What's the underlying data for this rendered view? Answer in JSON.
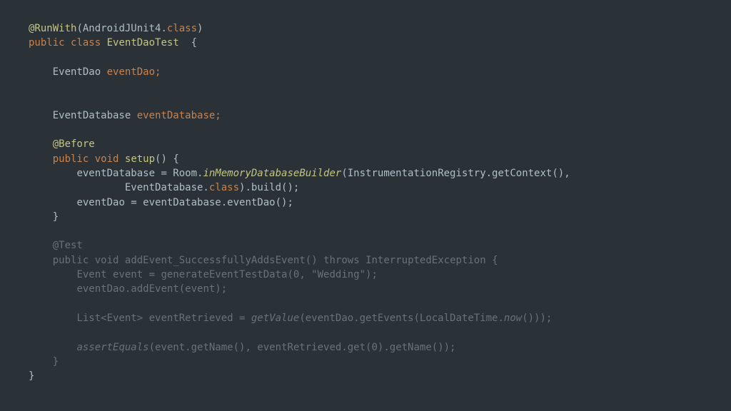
{
  "code": {
    "l1_ann": "@RunWith",
    "l1_open": "(AndroidJUnit4.",
    "l1_class": "class",
    "l1_close": ")",
    "l2_pub": "public",
    "l2_class": "class",
    "l2_name": "EventDaoTest",
    "l2_brace": "  {",
    "l4_type": "EventDao",
    "l4_field": "eventDao;",
    "l7_type": "EventDatabase",
    "l7_field": "eventDatabase;",
    "l9_ann": "@Before",
    "l10_pub": "public",
    "l10_void": "void",
    "l10_fn": "setup",
    "l10_tail": "() {",
    "l11_a": "eventDatabase = Room.",
    "l11_b": "inMemoryDatabaseBuilder",
    "l11_c": "(InstrumentationRegistry.getContext(),",
    "l12_a": "EventDatabase.",
    "l12_b": "class",
    "l12_c": ").build();",
    "l13": "eventDao = eventDatabase.eventDao();",
    "l14": "}",
    "l16_ann": "@Test",
    "l17_pub": "public",
    "l17_void": "void",
    "l17_fn": "addEvent_SuccessfullyAddsEvent",
    "l17_tail": "() ",
    "l17_throws": "throws",
    "l17_ex": " InterruptedException {",
    "l18_a": "Event event = generateEventTestData(",
    "l18_num": "0",
    "l18_b": ", ",
    "l18_str": "\"Wedding\"",
    "l18_c": ");",
    "l19": "eventDao.addEvent(event);",
    "l21_a": "List<Event> eventRetrieved = ",
    "l21_b": "getValue",
    "l21_c": "(eventDao.getEvents(LocalDateTime.",
    "l21_d": "now",
    "l21_e": "()));",
    "l23_a": "assertEquals",
    "l23_b": "(event.getName(), eventRetrieved.get(",
    "l23_num": "0",
    "l23_c": ").getName());",
    "l24": "}",
    "l25": "}"
  }
}
